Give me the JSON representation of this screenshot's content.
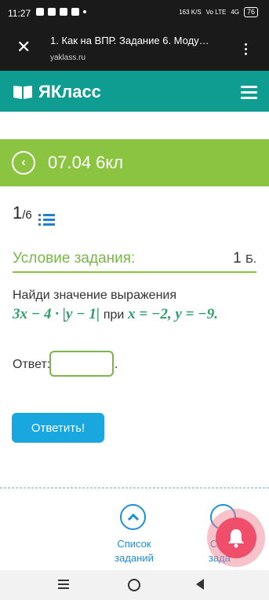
{
  "status": {
    "time": "11:27",
    "network_speed": "163 K/S",
    "network_type": "Vo LTE",
    "signal_label": "4G",
    "battery": "76"
  },
  "browser": {
    "title": "1. Как на ВПР. Задание 6. Моду…",
    "url": "yaklass.ru"
  },
  "site": {
    "logo_text": "ЯКласс",
    "brand_color": "#0f9c91"
  },
  "course": {
    "title": "07.04 6кл",
    "color": "#8bc440"
  },
  "progress": {
    "current": "1",
    "total": "/6"
  },
  "task": {
    "condition_label": "Условие задания:",
    "points_value": "1",
    "points_unit": "Б.",
    "prompt": "Найди значение выражения",
    "expr_main": "3x − 4 · |y − 1|",
    "expr_word": "при",
    "expr_vars": "x = −2, y = −9."
  },
  "answer": {
    "label": "Ответ:",
    "value": "",
    "suffix": "."
  },
  "buttons": {
    "submit": "Ответить!"
  },
  "bottom_nav": {
    "list_label_line1": "Список",
    "list_label_line2": "заданий",
    "next_label_line1": "Сле",
    "next_label_line2": "зада"
  }
}
